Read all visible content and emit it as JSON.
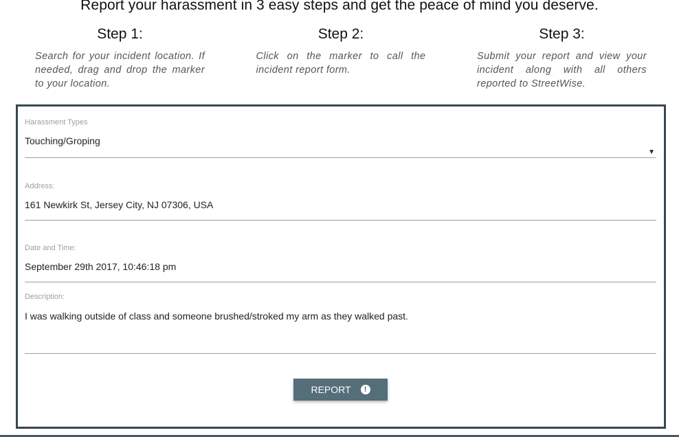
{
  "headline": "Report your harassment in 3 easy steps and get the peace of mind you deserve.",
  "steps": [
    {
      "title": "Step 1:",
      "text": "Search for your incident location. If needed, drag and drop the marker to your location."
    },
    {
      "title": "Step 2:",
      "text": "Click on the marker to call the incident report form."
    },
    {
      "title": "Step 3:",
      "text": "Submit your report and view your incident along with all others reported to StreetWise."
    }
  ],
  "form": {
    "harassment_types": {
      "label": "Harassment Types",
      "value": "Touching/Groping",
      "arrow": "▼"
    },
    "address": {
      "label": "Address:",
      "value": "161 Newkirk St, Jersey City, NJ 07306, USA"
    },
    "date_time": {
      "label": "Date and Time:",
      "value": "September 29th 2017, 10:46:18 pm"
    },
    "description": {
      "label": "Description:",
      "value": "I was walking outside of class and someone brushed/stroked my arm as they walked past."
    },
    "report_button": {
      "label": "REPORT",
      "icon_glyph": "!"
    }
  },
  "colors": {
    "card_border": "#37474f",
    "button_bg": "#546e7a"
  }
}
